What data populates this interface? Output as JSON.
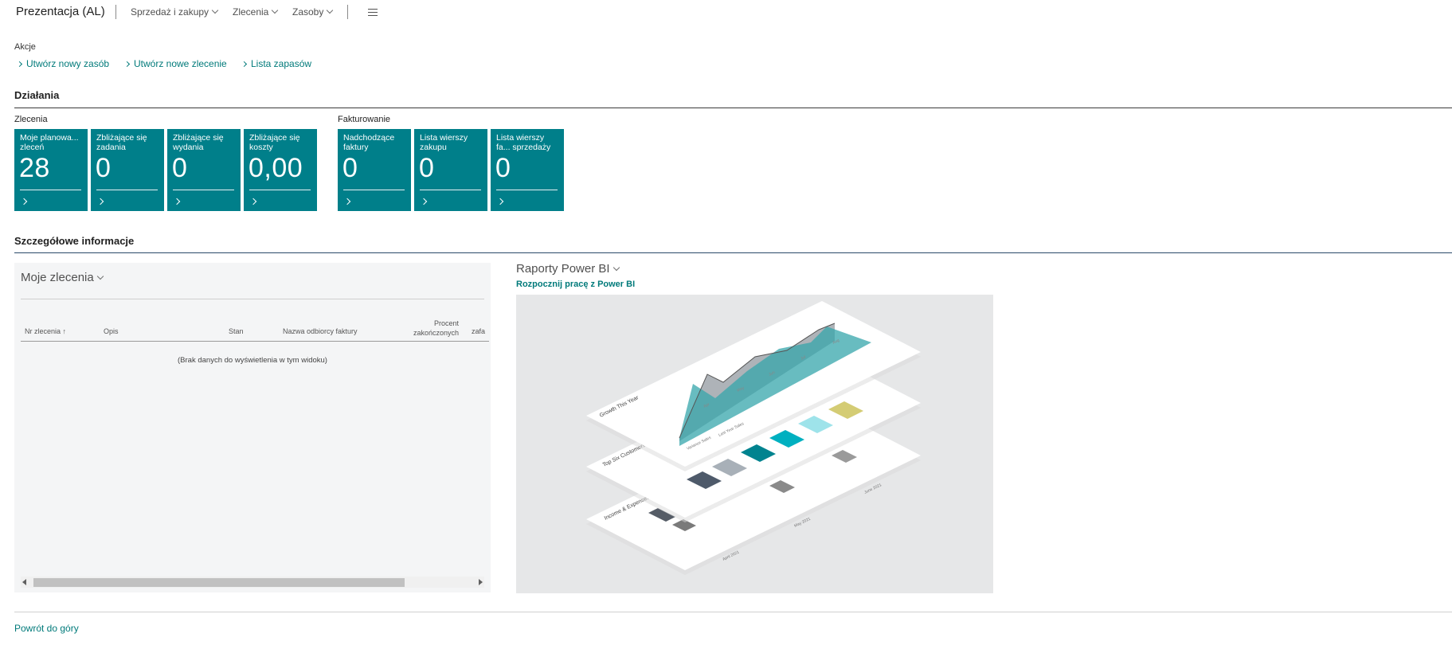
{
  "nav": {
    "title": "Prezentacja (AL)",
    "items": [
      {
        "label": "Sprzedaż i zakupy"
      },
      {
        "label": "Zlecenia"
      },
      {
        "label": "Zasoby"
      }
    ],
    "menu_icon": "hamburger-icon"
  },
  "actions": {
    "label": "Akcje",
    "links": [
      {
        "label": "Utwórz nowy zasób"
      },
      {
        "label": "Utwórz nowe zlecenie"
      },
      {
        "label": "Lista zapasów"
      }
    ]
  },
  "activities": {
    "title": "Działania",
    "groups": [
      {
        "label": "Zlecenia",
        "cues": [
          {
            "caption": "Moje planowa... zleceń",
            "value": "28"
          },
          {
            "caption": "Zbliżające się zadania",
            "value": "0"
          },
          {
            "caption": "Zbliżające się wydania",
            "value": "0"
          },
          {
            "caption": "Zbliżające się koszty",
            "value": "0,00"
          }
        ]
      },
      {
        "label": "Fakturowanie",
        "cues": [
          {
            "caption": "Nadchodzące faktury",
            "value": "0"
          },
          {
            "caption": "Lista wierszy zakupu",
            "value": "0"
          },
          {
            "caption": "Lista wierszy fa... sprzedaży",
            "value": "0"
          }
        ]
      }
    ],
    "tile_color": "#007f8a"
  },
  "details": {
    "title": "Szczegółowe informacje",
    "my_orders": {
      "title": "Moje zlecenia",
      "columns": [
        "Nr zlecenia ↑",
        "Opis",
        "Stan",
        "Nazwa odbiorcy faktury",
        "Procent zakończonych",
        "zafa"
      ],
      "empty_text": "(Brak danych do wyświetlenia w tym widoku)"
    },
    "powerbi": {
      "title": "Raporty Power BI",
      "link": "Rozpocznij pracę z Power BI",
      "illustration": {
        "top_panel": "Growth This Year",
        "legend": [
          "Variance Sales",
          "Last Year Sales"
        ],
        "months": [
          "Apr",
          "May",
          "Jun",
          "Jul",
          "Aug"
        ],
        "middle_panel": "Top Six Customers",
        "middle_labels": [
          "Coho Winery",
          "Litware Inc.",
          "Trey Research",
          "Alpine Ski",
          "Sportsland",
          "Contoso"
        ],
        "bottom_panel": "Income & Expenses",
        "bottom_labels": [
          "April 2021",
          "May 2021",
          "June 2021"
        ]
      }
    }
  },
  "footer": {
    "back_to_top": "Powrót do góry"
  }
}
